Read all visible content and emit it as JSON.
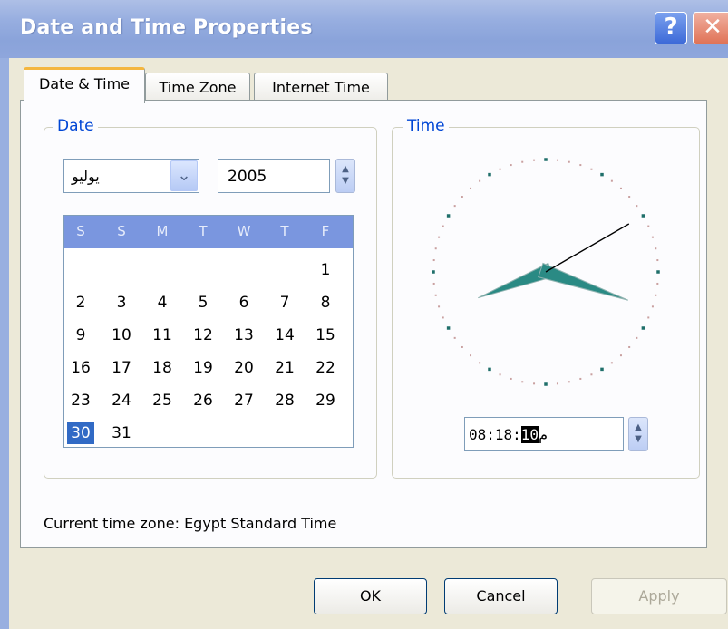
{
  "window": {
    "title": "Date and Time Properties",
    "help_glyph": "?",
    "close_glyph": "✕"
  },
  "tabs": [
    {
      "label": "Date & Time",
      "active": true
    },
    {
      "label": "Time Zone",
      "active": false
    },
    {
      "label": "Internet Time",
      "active": false
    }
  ],
  "date": {
    "group_label": "Date",
    "month": "يوليو",
    "year": "2005",
    "day_names": [
      "S",
      "S",
      "M",
      "T",
      "W",
      "T",
      "F"
    ],
    "weeks": [
      [
        "",
        "",
        "",
        "",
        "",
        "",
        "1"
      ],
      [
        "2",
        "3",
        "4",
        "5",
        "6",
        "7",
        "8"
      ],
      [
        "9",
        "10",
        "11",
        "12",
        "13",
        "14",
        "15"
      ],
      [
        "16",
        "17",
        "18",
        "19",
        "20",
        "21",
        "22"
      ],
      [
        "23",
        "24",
        "25",
        "26",
        "27",
        "28",
        "29"
      ],
      [
        "30",
        "31",
        "",
        "",
        "",
        "",
        ""
      ]
    ],
    "selected_day": "30"
  },
  "time": {
    "group_label": "Time",
    "hours_minutes": "08:18:",
    "seconds": "10",
    "ampm": "م",
    "clock": {
      "hour": 8,
      "minute": 18,
      "second": 10
    }
  },
  "timezone": {
    "text": "Current time zone:  Egypt Standard Time"
  },
  "buttons": {
    "ok": "OK",
    "cancel": "Cancel",
    "apply": "Apply"
  },
  "colors": {
    "title_bar": "#97aee0",
    "calendar_header": "#7a96df",
    "selection": "#316ac5",
    "clock_hand": "#2a8a84",
    "group_label": "#0046d5"
  }
}
